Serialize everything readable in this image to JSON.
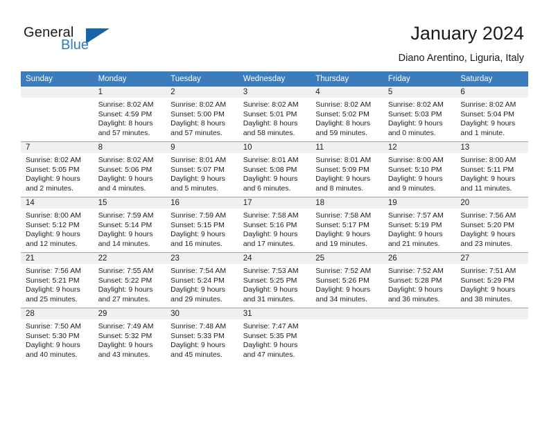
{
  "brand": {
    "name_part1": "General",
    "name_part2": "Blue",
    "logo_icon": "triangle-logo-icon",
    "accent_color": "#1565a8",
    "secondary_color": "#2b7cc4"
  },
  "header": {
    "title": "January 2024",
    "subtitle": "Diano Arentino, Liguria, Italy"
  },
  "calendar": {
    "header_bg_color": "#3a7cbe",
    "daynum_bg_color": "#f0f0f0",
    "weekday_headers": [
      "Sunday",
      "Monday",
      "Tuesday",
      "Wednesday",
      "Thursday",
      "Friday",
      "Saturday"
    ],
    "weeks": [
      [
        {
          "day": "",
          "sunrise": "",
          "sunset": "",
          "daylight_line1": "",
          "daylight_line2": ""
        },
        {
          "day": "1",
          "sunrise": "Sunrise: 8:02 AM",
          "sunset": "Sunset: 4:59 PM",
          "daylight_line1": "Daylight: 8 hours",
          "daylight_line2": "and 57 minutes."
        },
        {
          "day": "2",
          "sunrise": "Sunrise: 8:02 AM",
          "sunset": "Sunset: 5:00 PM",
          "daylight_line1": "Daylight: 8 hours",
          "daylight_line2": "and 57 minutes."
        },
        {
          "day": "3",
          "sunrise": "Sunrise: 8:02 AM",
          "sunset": "Sunset: 5:01 PM",
          "daylight_line1": "Daylight: 8 hours",
          "daylight_line2": "and 58 minutes."
        },
        {
          "day": "4",
          "sunrise": "Sunrise: 8:02 AM",
          "sunset": "Sunset: 5:02 PM",
          "daylight_line1": "Daylight: 8 hours",
          "daylight_line2": "and 59 minutes."
        },
        {
          "day": "5",
          "sunrise": "Sunrise: 8:02 AM",
          "sunset": "Sunset: 5:03 PM",
          "daylight_line1": "Daylight: 9 hours",
          "daylight_line2": "and 0 minutes."
        },
        {
          "day": "6",
          "sunrise": "Sunrise: 8:02 AM",
          "sunset": "Sunset: 5:04 PM",
          "daylight_line1": "Daylight: 9 hours",
          "daylight_line2": "and 1 minute."
        }
      ],
      [
        {
          "day": "7",
          "sunrise": "Sunrise: 8:02 AM",
          "sunset": "Sunset: 5:05 PM",
          "daylight_line1": "Daylight: 9 hours",
          "daylight_line2": "and 2 minutes."
        },
        {
          "day": "8",
          "sunrise": "Sunrise: 8:02 AM",
          "sunset": "Sunset: 5:06 PM",
          "daylight_line1": "Daylight: 9 hours",
          "daylight_line2": "and 4 minutes."
        },
        {
          "day": "9",
          "sunrise": "Sunrise: 8:01 AM",
          "sunset": "Sunset: 5:07 PM",
          "daylight_line1": "Daylight: 9 hours",
          "daylight_line2": "and 5 minutes."
        },
        {
          "day": "10",
          "sunrise": "Sunrise: 8:01 AM",
          "sunset": "Sunset: 5:08 PM",
          "daylight_line1": "Daylight: 9 hours",
          "daylight_line2": "and 6 minutes."
        },
        {
          "day": "11",
          "sunrise": "Sunrise: 8:01 AM",
          "sunset": "Sunset: 5:09 PM",
          "daylight_line1": "Daylight: 9 hours",
          "daylight_line2": "and 8 minutes."
        },
        {
          "day": "12",
          "sunrise": "Sunrise: 8:00 AM",
          "sunset": "Sunset: 5:10 PM",
          "daylight_line1": "Daylight: 9 hours",
          "daylight_line2": "and 9 minutes."
        },
        {
          "day": "13",
          "sunrise": "Sunrise: 8:00 AM",
          "sunset": "Sunset: 5:11 PM",
          "daylight_line1": "Daylight: 9 hours",
          "daylight_line2": "and 11 minutes."
        }
      ],
      [
        {
          "day": "14",
          "sunrise": "Sunrise: 8:00 AM",
          "sunset": "Sunset: 5:12 PM",
          "daylight_line1": "Daylight: 9 hours",
          "daylight_line2": "and 12 minutes."
        },
        {
          "day": "15",
          "sunrise": "Sunrise: 7:59 AM",
          "sunset": "Sunset: 5:14 PM",
          "daylight_line1": "Daylight: 9 hours",
          "daylight_line2": "and 14 minutes."
        },
        {
          "day": "16",
          "sunrise": "Sunrise: 7:59 AM",
          "sunset": "Sunset: 5:15 PM",
          "daylight_line1": "Daylight: 9 hours",
          "daylight_line2": "and 16 minutes."
        },
        {
          "day": "17",
          "sunrise": "Sunrise: 7:58 AM",
          "sunset": "Sunset: 5:16 PM",
          "daylight_line1": "Daylight: 9 hours",
          "daylight_line2": "and 17 minutes."
        },
        {
          "day": "18",
          "sunrise": "Sunrise: 7:58 AM",
          "sunset": "Sunset: 5:17 PM",
          "daylight_line1": "Daylight: 9 hours",
          "daylight_line2": "and 19 minutes."
        },
        {
          "day": "19",
          "sunrise": "Sunrise: 7:57 AM",
          "sunset": "Sunset: 5:19 PM",
          "daylight_line1": "Daylight: 9 hours",
          "daylight_line2": "and 21 minutes."
        },
        {
          "day": "20",
          "sunrise": "Sunrise: 7:56 AM",
          "sunset": "Sunset: 5:20 PM",
          "daylight_line1": "Daylight: 9 hours",
          "daylight_line2": "and 23 minutes."
        }
      ],
      [
        {
          "day": "21",
          "sunrise": "Sunrise: 7:56 AM",
          "sunset": "Sunset: 5:21 PM",
          "daylight_line1": "Daylight: 9 hours",
          "daylight_line2": "and 25 minutes."
        },
        {
          "day": "22",
          "sunrise": "Sunrise: 7:55 AM",
          "sunset": "Sunset: 5:22 PM",
          "daylight_line1": "Daylight: 9 hours",
          "daylight_line2": "and 27 minutes."
        },
        {
          "day": "23",
          "sunrise": "Sunrise: 7:54 AM",
          "sunset": "Sunset: 5:24 PM",
          "daylight_line1": "Daylight: 9 hours",
          "daylight_line2": "and 29 minutes."
        },
        {
          "day": "24",
          "sunrise": "Sunrise: 7:53 AM",
          "sunset": "Sunset: 5:25 PM",
          "daylight_line1": "Daylight: 9 hours",
          "daylight_line2": "and 31 minutes."
        },
        {
          "day": "25",
          "sunrise": "Sunrise: 7:52 AM",
          "sunset": "Sunset: 5:26 PM",
          "daylight_line1": "Daylight: 9 hours",
          "daylight_line2": "and 34 minutes."
        },
        {
          "day": "26",
          "sunrise": "Sunrise: 7:52 AM",
          "sunset": "Sunset: 5:28 PM",
          "daylight_line1": "Daylight: 9 hours",
          "daylight_line2": "and 36 minutes."
        },
        {
          "day": "27",
          "sunrise": "Sunrise: 7:51 AM",
          "sunset": "Sunset: 5:29 PM",
          "daylight_line1": "Daylight: 9 hours",
          "daylight_line2": "and 38 minutes."
        }
      ],
      [
        {
          "day": "28",
          "sunrise": "Sunrise: 7:50 AM",
          "sunset": "Sunset: 5:30 PM",
          "daylight_line1": "Daylight: 9 hours",
          "daylight_line2": "and 40 minutes."
        },
        {
          "day": "29",
          "sunrise": "Sunrise: 7:49 AM",
          "sunset": "Sunset: 5:32 PM",
          "daylight_line1": "Daylight: 9 hours",
          "daylight_line2": "and 43 minutes."
        },
        {
          "day": "30",
          "sunrise": "Sunrise: 7:48 AM",
          "sunset": "Sunset: 5:33 PM",
          "daylight_line1": "Daylight: 9 hours",
          "daylight_line2": "and 45 minutes."
        },
        {
          "day": "31",
          "sunrise": "Sunrise: 7:47 AM",
          "sunset": "Sunset: 5:35 PM",
          "daylight_line1": "Daylight: 9 hours",
          "daylight_line2": "and 47 minutes."
        },
        {
          "day": "",
          "sunrise": "",
          "sunset": "",
          "daylight_line1": "",
          "daylight_line2": ""
        },
        {
          "day": "",
          "sunrise": "",
          "sunset": "",
          "daylight_line1": "",
          "daylight_line2": ""
        },
        {
          "day": "",
          "sunrise": "",
          "sunset": "",
          "daylight_line1": "",
          "daylight_line2": ""
        }
      ]
    ]
  }
}
